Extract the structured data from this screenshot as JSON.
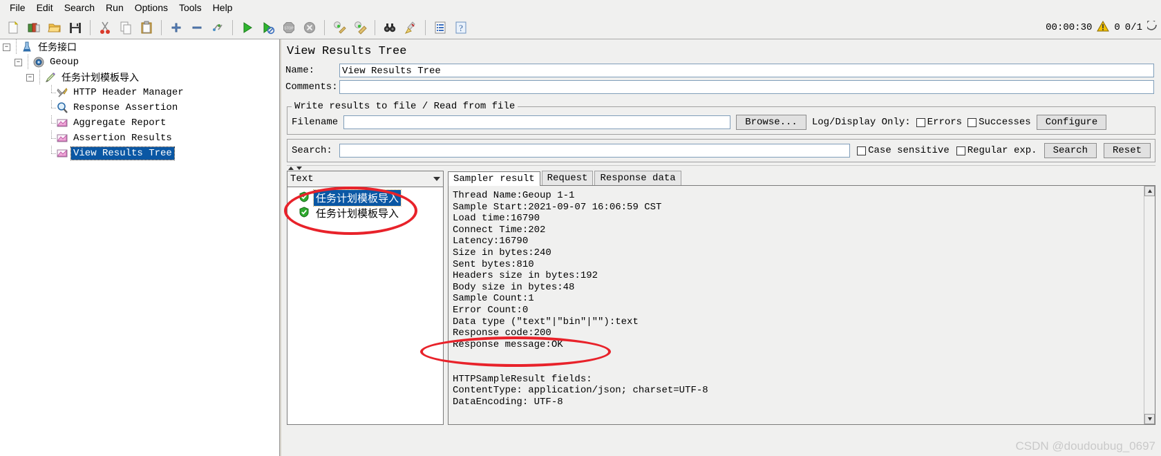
{
  "menu": {
    "items": [
      {
        "label": "File",
        "name": "menu-file"
      },
      {
        "label": "Edit",
        "name": "menu-edit"
      },
      {
        "label": "Search",
        "name": "menu-search"
      },
      {
        "label": "Run",
        "name": "menu-run"
      },
      {
        "label": "Options",
        "name": "menu-options"
      },
      {
        "label": "Tools",
        "name": "menu-tools"
      },
      {
        "label": "Help",
        "name": "menu-help"
      }
    ]
  },
  "status": {
    "timer": "00:00:30",
    "warning_count": "0",
    "threads": "0/1"
  },
  "tree": {
    "nodes": [
      {
        "label": "任务接口",
        "icon": "test-plan-icon"
      },
      {
        "label": "Geoup",
        "icon": "thread-group-icon"
      },
      {
        "label": "任务计划模板导入",
        "icon": "http-sampler-icon"
      },
      {
        "label": "HTTP Header Manager",
        "icon": "header-manager-icon"
      },
      {
        "label": "Response Assertion",
        "icon": "assertion-icon"
      },
      {
        "label": "Aggregate Report",
        "icon": "report-icon"
      },
      {
        "label": "Assertion Results",
        "icon": "report-icon"
      },
      {
        "label": "View Results Tree",
        "icon": "report-icon"
      }
    ]
  },
  "panel": {
    "title": "View Results Tree",
    "name_label": "Name:",
    "name_value": "View Results Tree",
    "comments_label": "Comments:",
    "comments_value": "",
    "file_group_legend": "Write results to file / Read from file",
    "filename_label": "Filename",
    "filename_value": "",
    "browse_label": "Browse...",
    "log_display_label": "Log/Display Only:",
    "errors_label": "Errors",
    "successes_label": "Successes",
    "configure_label": "Configure"
  },
  "search": {
    "label": "Search:",
    "value": "",
    "case_sensitive_label": "Case sensitive",
    "regular_exp_label": "Regular exp.",
    "search_button": "Search",
    "reset_button": "Reset"
  },
  "results": {
    "renderer_selected": "Text",
    "entries": [
      {
        "label": "任务计划模板导入",
        "status": "success",
        "selected": true
      },
      {
        "label": "任务计划模板导入",
        "status": "success",
        "selected": false
      }
    ],
    "tabs": [
      {
        "label": "Sampler result",
        "active": true
      },
      {
        "label": "Request",
        "active": false
      },
      {
        "label": "Response data",
        "active": false
      }
    ],
    "sampler_result": "Thread Name:Geoup 1-1\nSample Start:2021-09-07 16:06:59 CST\nLoad time:16790\nConnect Time:202\nLatency:16790\nSize in bytes:240\nSent bytes:810\nHeaders size in bytes:192\nBody size in bytes:48\nSample Count:1\nError Count:0\nData type (\"text\"|\"bin\"|\"\"):text\nResponse code:200\nResponse message:OK\n\n\nHTTPSampleResult fields:\nContentType: application/json; charset=UTF-8\nDataEncoding: UTF-8"
  },
  "watermark": "CSDN @doudoubug_0697",
  "colors": {
    "annotation": "#e8222a",
    "selection": "#0a57a4",
    "success": "#22a12a",
    "warning": "#f2c200"
  }
}
